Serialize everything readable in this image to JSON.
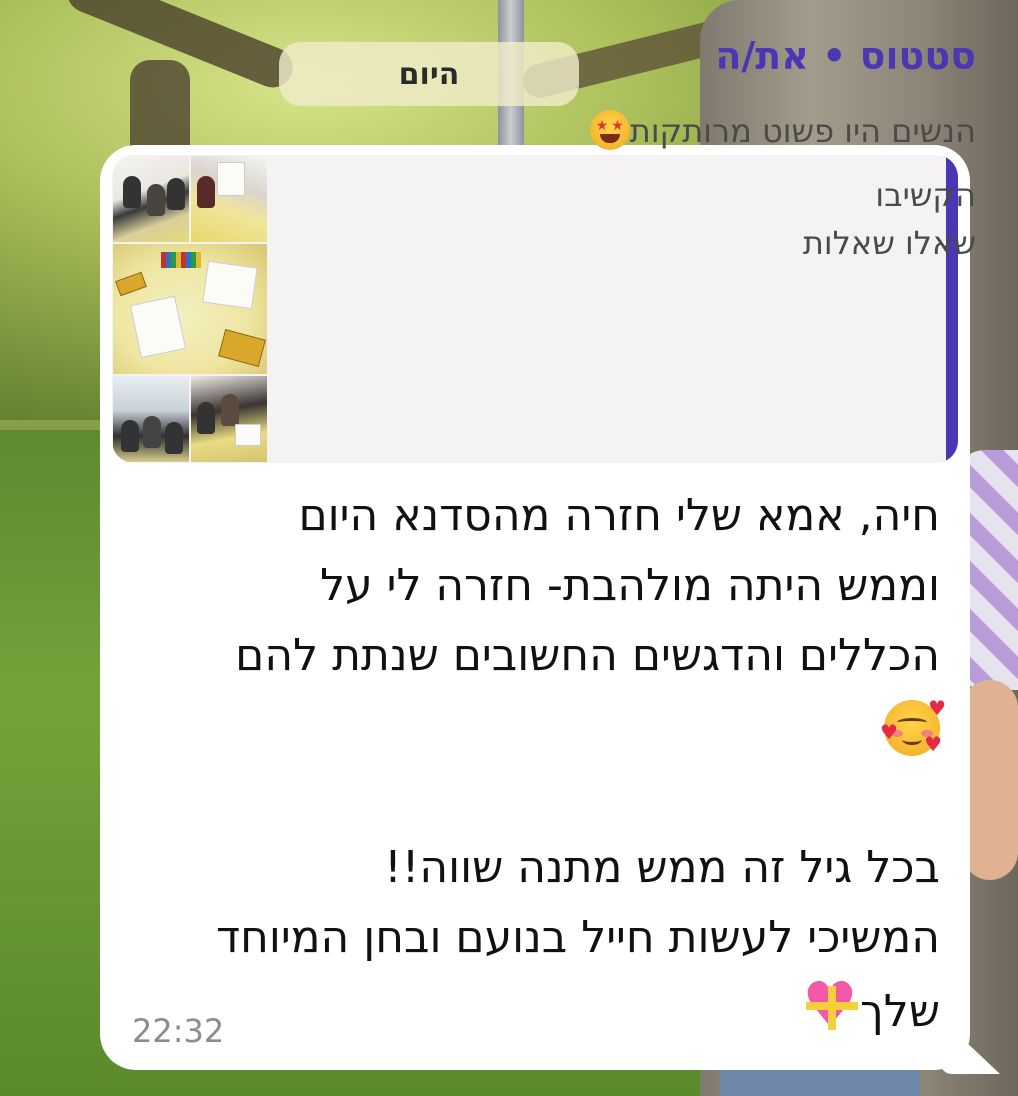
{
  "date_separator": {
    "label": "היום"
  },
  "quoted_status": {
    "title": "סטטוס • את/ה",
    "lines": [
      "הנשים היו פשוט מרותקות",
      "הקשיבו",
      "שאלו שאלות"
    ],
    "emoji": "star-struck-icon",
    "accent_color": "#4b37b4"
  },
  "message": {
    "lines": [
      "חיה, אמא שלי חזרה מהסדנא היום",
      "וממש היתה מולהבת- חזרה לי על",
      "הכללים והדגשים החשובים שנתת להם",
      "",
      "בכל גיל זה ממש מתנה שווה!!",
      "המשיכי לעשות חייל בנועם ובחן המיוחד",
      "שלך"
    ],
    "emojis": [
      "smiling-face-with-hearts-icon",
      "heart-with-ribbon-icon"
    ],
    "timestamp": "22:32"
  }
}
